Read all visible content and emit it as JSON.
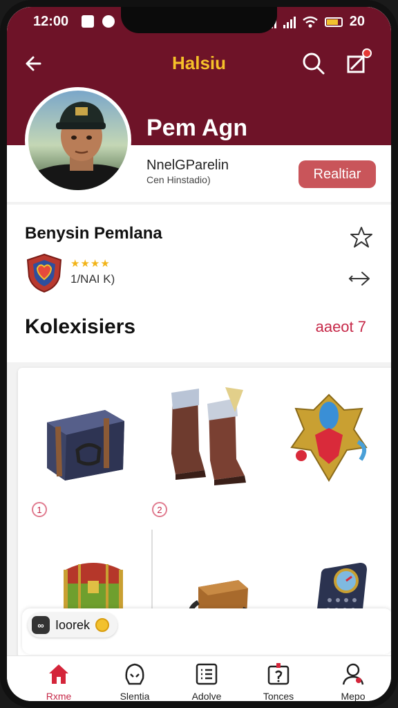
{
  "status_bar": {
    "time": "12:00",
    "battery_text": "20"
  },
  "header": {
    "title": "Halsiu"
  },
  "profile": {
    "name": "Pem Agn",
    "subtitle": "NnelGParelin",
    "meta": "Cen Hinstadio)",
    "action_label": "Realtiar"
  },
  "guild": {
    "title": "Benysin Pemlana",
    "stars": "★★★★",
    "code": "1/NAI K)"
  },
  "collections": {
    "title": "Kolexisiers",
    "link_label": "aaeot 7",
    "items": [
      {
        "name": "armored-chest-icon",
        "badge": "1"
      },
      {
        "name": "leather-boots-icon",
        "badge": "2"
      },
      {
        "name": "jeweled-emblem-icon",
        "badge": ""
      },
      {
        "name": "treasure-chest-icon",
        "badge": ""
      },
      {
        "name": "wooden-trap-icon",
        "badge": ""
      },
      {
        "name": "radio-device-icon",
        "badge": ""
      }
    ]
  },
  "toast": {
    "text": "Ioorek"
  },
  "bottom_nav": [
    {
      "label": "Rxme",
      "icon": "home-icon",
      "active": true
    },
    {
      "label": "Slentia",
      "icon": "helmet-icon",
      "active": false
    },
    {
      "label": "Adolve",
      "icon": "list-icon",
      "active": false
    },
    {
      "label": "Tonces",
      "icon": "calendar-icon",
      "active": false
    },
    {
      "label": "Mepo",
      "icon": "profile-icon",
      "active": false
    }
  ],
  "colors": {
    "header_bg": "#6e1328",
    "accent": "#c62848",
    "title_gold": "#f6c129",
    "button_bg": "#c9555a"
  }
}
